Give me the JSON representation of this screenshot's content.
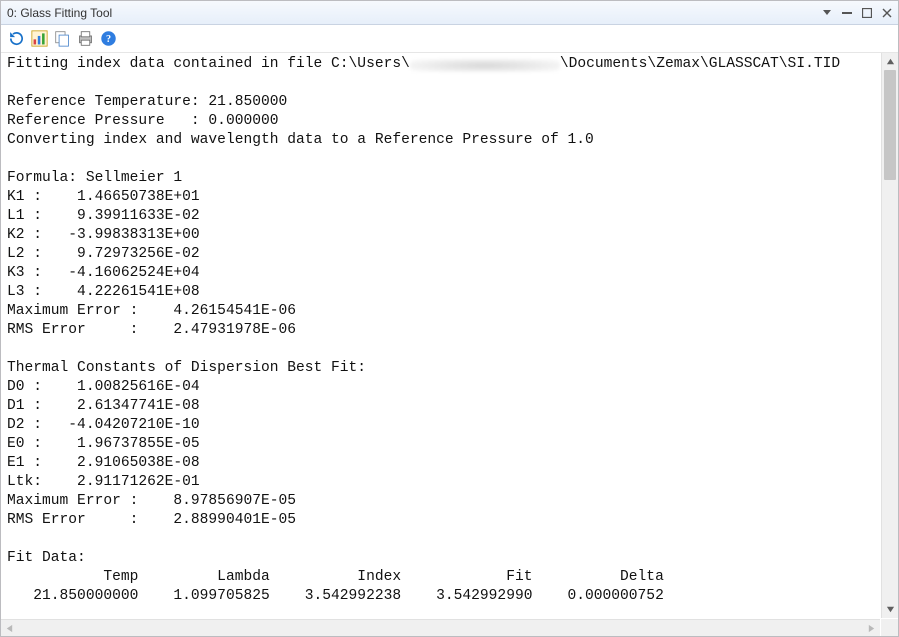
{
  "window": {
    "title": "0: Glass Fitting Tool"
  },
  "toolbar": {
    "icons": [
      "refresh",
      "chart",
      "copy",
      "print",
      "help"
    ]
  },
  "output": {
    "intro_prefix": "Fitting index data contained in file C:\\Users\\",
    "intro_suffix": "\\Documents\\Zemax\\GLASSCAT\\SI.TID",
    "ref_temp": "Reference Temperature: 21.850000",
    "ref_pres": "Reference Pressure   : 0.000000",
    "conv": "Converting index and wavelength data to a Reference Pressure of 1.0",
    "formula": "Formula: Sellmeier 1",
    "k1": "K1 :    1.46650738E+01",
    "l1": "L1 :    9.39911633E-02",
    "k2": "K2 :   -3.99838313E+00",
    "l2": "L2 :    9.72973256E-02",
    "k3": "K3 :   -4.16062524E+04",
    "l3": "L3 :    4.22261541E+08",
    "maxerr1": "Maximum Error :    4.26154541E-06",
    "rmserr1": "RMS Error     :    2.47931978E-06",
    "thermal_hdr": "Thermal Constants of Dispersion Best Fit:",
    "d0": "D0 :    1.00825616E-04",
    "d1": "D1 :    2.61347741E-08",
    "d2": "D2 :   -4.04207210E-10",
    "e0": "E0 :    1.96737855E-05",
    "e1": "E1 :    2.91065038E-08",
    "ltk": "Ltk:    2.91171262E-01",
    "maxerr2": "Maximum Error :    8.97856907E-05",
    "rmserr2": "RMS Error     :    2.88990401E-05",
    "fitdata_hdr": "Fit Data:",
    "fitdata_cols": "           Temp         Lambda          Index            Fit          Delta",
    "fitdata_row1": "   21.850000000    1.099705825    3.542992238    3.542992990    0.000000752"
  }
}
